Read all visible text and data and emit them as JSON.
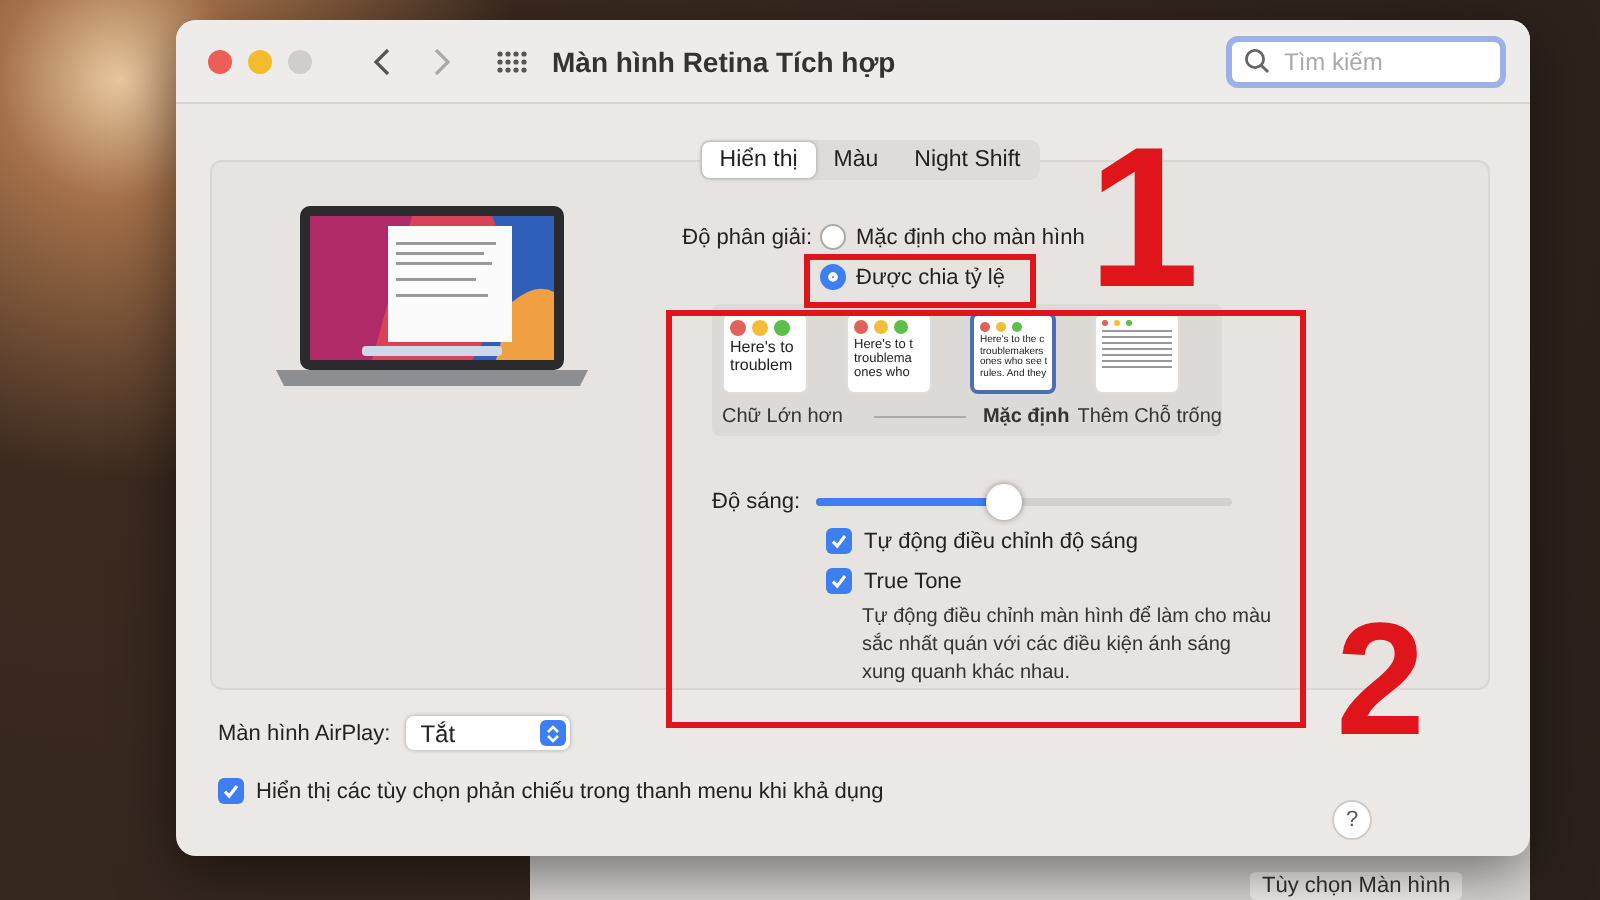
{
  "window": {
    "title": "Màn hình Retina Tích hợp"
  },
  "search": {
    "placeholder": "Tìm kiếm"
  },
  "tabs": [
    {
      "label": "Hiển thị",
      "selected": true
    },
    {
      "label": "Màu",
      "selected": false
    },
    {
      "label": "Night Shift",
      "selected": false
    }
  ],
  "resolution": {
    "label": "Độ phân giải:",
    "options": [
      {
        "label": "Mặc định cho màn hình",
        "selected": false
      },
      {
        "label": "Được chia tỷ lệ",
        "selected": true
      }
    ]
  },
  "scales": [
    {
      "kind": "large",
      "preview_lines": [
        "Here's to",
        "troublem"
      ],
      "label": "Chữ Lớn hơn",
      "selected": false
    },
    {
      "kind": "medium",
      "preview_lines": [
        "Here's to t",
        "troublema",
        "ones who"
      ],
      "selected": false
    },
    {
      "kind": "default",
      "preview_lines": [
        "Here's to the c",
        "troublemakers",
        "ones who see t",
        "rules. And they"
      ],
      "label": "Mặc định",
      "selected": true
    },
    {
      "kind": "small",
      "label": "Thêm Chỗ trống",
      "selected": false
    }
  ],
  "brightness": {
    "label": "Độ sáng:",
    "level": 0.45
  },
  "options": [
    {
      "label": "Tự động điều chỉnh độ sáng",
      "checked": true
    },
    {
      "label": "True Tone",
      "checked": true
    }
  ],
  "true_tone_note": "Tự động điều chỉnh màn hình để làm cho màu sắc nhất quán với các điều kiện ánh sáng xung quanh khác nhau.",
  "airplay": {
    "label": "Màn hình AirPlay:",
    "value": "Tắt"
  },
  "mirror_option": {
    "label": "Hiển thị các tùy chọn phản chiếu trong thanh menu khi khả dụng",
    "checked": true
  },
  "help": "?",
  "background_button": "Tùy chọn Màn hình",
  "annotations": [
    "1",
    "2"
  ]
}
